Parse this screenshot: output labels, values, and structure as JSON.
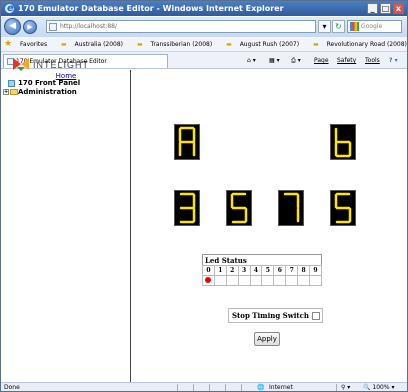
{
  "window": {
    "title": "170 Emulator Database Editor - Windows Internet Explorer",
    "minimize": "_",
    "maximize": "□",
    "close": "x"
  },
  "address": {
    "url": "http://localhost:88/",
    "search_placeholder": "Google"
  },
  "favorites": {
    "label": "Favorites",
    "items": [
      "Australia (2008)",
      "Transsiberian (2008)",
      "August Rush (2007)",
      "Revolutionary Road (2008)"
    ]
  },
  "tab": {
    "label": "170 Emulator Database Editor"
  },
  "commands": {
    "page": "Page",
    "safety": "Safety",
    "tools": "Tools"
  },
  "logo": {
    "text": "INTELIGHT"
  },
  "sidebar": {
    "home": "Home",
    "front_panel": "170 Front Panel",
    "administration": "Administration"
  },
  "display": {
    "top": [
      "A",
      "b"
    ],
    "bottom": [
      "3",
      "5",
      "7",
      "5"
    ]
  },
  "led_status": {
    "title": "Led Status",
    "headers": [
      "0",
      "1",
      "2",
      "3",
      "4",
      "5",
      "6",
      "7",
      "8",
      "9"
    ],
    "lit": [
      0
    ]
  },
  "stop_timing": {
    "label": "Stop Timing Switch"
  },
  "apply": {
    "label": "Apply"
  },
  "status": {
    "left": "Done",
    "zone": "Internet",
    "zoom": "100%"
  },
  "colors": {
    "segment": "#ffe400",
    "led_on": "#e8000b"
  }
}
